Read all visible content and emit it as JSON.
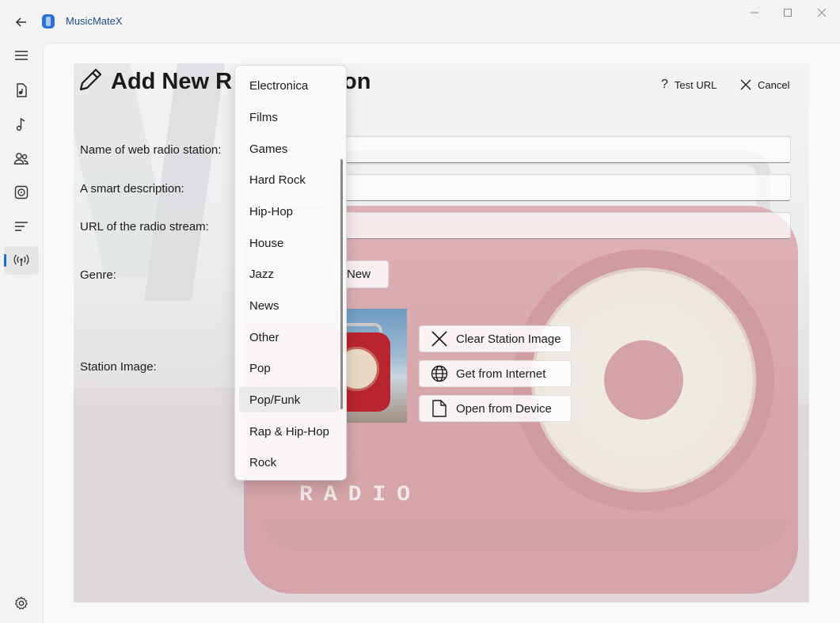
{
  "window": {
    "title": "MusicMateX"
  },
  "nav": {
    "items": [
      {
        "icon": "hamburger-menu-icon"
      },
      {
        "icon": "music-file-icon"
      },
      {
        "icon": "music-note-icon"
      },
      {
        "icon": "artists-icon"
      },
      {
        "icon": "albums-icon"
      },
      {
        "icon": "playlist-icon"
      },
      {
        "icon": "radio-icon",
        "active": true
      },
      {
        "icon": "settings-icon"
      }
    ],
    "accent": "#1a6ed8"
  },
  "header": {
    "title_visible": "Add New R",
    "title_tail": "on",
    "test_url_label": "Test URL",
    "cancel_label": "Cancel"
  },
  "form": {
    "name_label": "Name of web radio station:",
    "description_label": "A smart description:",
    "url_label": "URL of the radio stream:",
    "genre_label": "Genre:",
    "new_button_label": "New",
    "image_label": "Station Image:",
    "clear_image_label": "Clear Station Image",
    "get_from_internet_label": "Get from Internet",
    "open_from_device_label": "Open from Device"
  },
  "genre_dropdown": {
    "items": [
      "Electronica",
      "Films",
      "Games",
      "Hard Rock",
      "Hip-Hop",
      "House",
      "Jazz",
      "News",
      "Other",
      "Pop",
      "Pop/Funk",
      "Rap & Hip-Hop",
      "Rock"
    ],
    "selected": "Pop/Funk"
  },
  "background": {
    "radio_word": "RADIO"
  }
}
